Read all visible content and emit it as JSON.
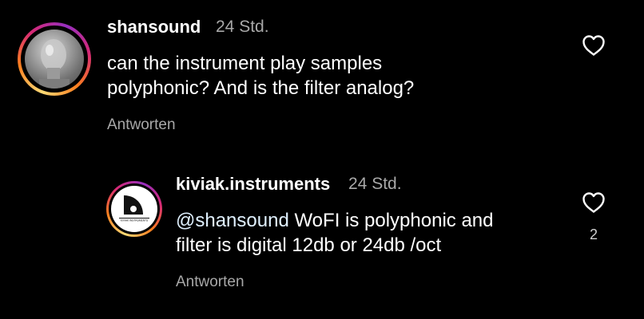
{
  "comment": {
    "username": "shansound",
    "time": "24 Std.",
    "lines": [
      "can the instrument play samples",
      "polyphonic? And is the filter analog?"
    ],
    "reply_label": "Antworten",
    "avatar_icon": "user-photo-icon"
  },
  "reply": {
    "username": "kiviak.instruments",
    "time": "24 Std.",
    "mention": "@shansound",
    "line1_rest": " WoFI is polyphonic and",
    "line2": "filter is digital 12db or 24db /oct",
    "reply_label": "Antworten",
    "like_count": "2",
    "avatar_icon": "kiviak-logo-icon",
    "logo_text": "KIVIAK INSTRUMENTS"
  },
  "colors": {
    "background": "#000000",
    "mention": "#e0f1ff",
    "secondary_text": "#a8a8a8"
  }
}
